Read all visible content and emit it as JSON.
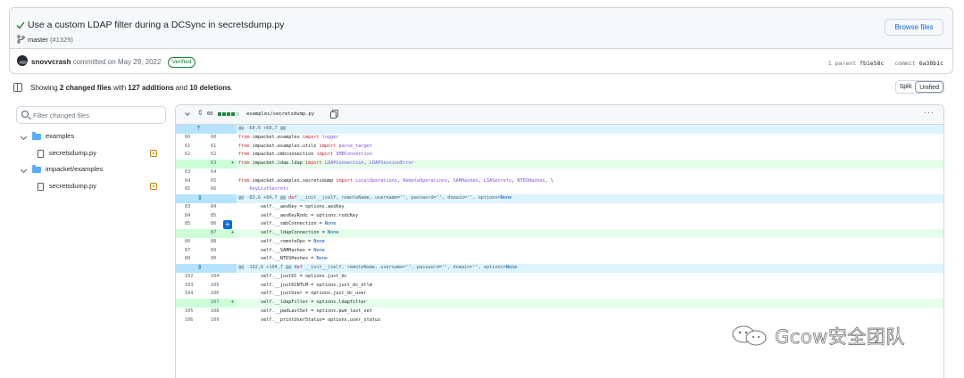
{
  "commit": {
    "title": "Use a custom LDAP filter during a DCSync in secretsdump.py",
    "branch": "master",
    "pr": "(#1329)",
    "browse_label": "Browse files",
    "author": "snovvcrash",
    "committed_text": "committed on May 29, 2022",
    "verified_label": "Verified",
    "parent_label": "1 parent",
    "parent_sha": "fb1e58c",
    "commit_label": "commit",
    "commit_sha": "6a38b1c"
  },
  "summary": {
    "prefix": "Showing",
    "files": "2 changed files",
    "mid": "with",
    "additions": "127 additions",
    "and": "and",
    "deletions": "10 deletions",
    "suffix": ".",
    "split_label": "Split",
    "unified_label": "Unified"
  },
  "tree": {
    "filter_placeholder": "Filter changed files",
    "items": [
      {
        "label": "examples"
      },
      {
        "label": "secretsdump.py"
      },
      {
        "label": "impacket/examples"
      },
      {
        "label": "secretsdump.py"
      }
    ]
  },
  "diff_header": {
    "count": "60",
    "path": "examples/secretsdump.py",
    "more": "···",
    "expand": "⇕"
  },
  "diff_lines": [
    {
      "type": "hunk",
      "old": "",
      "new": "",
      "code": "@@ -60,6 +60,7 @@"
    },
    {
      "type": "ctx",
      "old": "60",
      "new": "60",
      "code": "from impacket.examples import logger"
    },
    {
      "type": "ctx",
      "old": "61",
      "new": "61",
      "code": "from impacket.examples.utils import parse_target"
    },
    {
      "type": "ctx",
      "old": "62",
      "new": "62",
      "code": "from impacket.smbconnection import SMBConnection"
    },
    {
      "type": "add",
      "old": "",
      "new": "63",
      "code": "from impacket.ldap.ldap import LDAPConnection, LDAPSessionError"
    },
    {
      "type": "ctx",
      "old": "63",
      "new": "64",
      "code": ""
    },
    {
      "type": "ctx",
      "old": "64",
      "new": "65",
      "code": "from impacket.examples.secretsdump import LocalOperations, RemoteOperations, SAMHashes, LSASecrets, NTDSHashes, \\"
    },
    {
      "type": "ctx",
      "old": "65",
      "new": "66",
      "code": "    KeyListSecrets"
    },
    {
      "type": "hunk",
      "old": "",
      "new": "",
      "code": "@@ -83,6 +84,7 @@ def __init__(self, remoteName, username='', password='', domain='', options=None"
    },
    {
      "type": "ctx",
      "old": "83",
      "new": "84",
      "code": "        self.__aesKey = options.aesKey"
    },
    {
      "type": "ctx",
      "old": "84",
      "new": "85",
      "code": "        self.__aesKeyRodc = options.rodcKey"
    },
    {
      "type": "ctx",
      "old": "85",
      "new": "86",
      "code": "        self.__smbConnection = None"
    },
    {
      "type": "add",
      "old": "",
      "new": "87",
      "code": "        self.__ldapConnection = None"
    },
    {
      "type": "ctx",
      "old": "86",
      "new": "88",
      "code": "        self.__remoteOps = None"
    },
    {
      "type": "ctx",
      "old": "87",
      "new": "89",
      "code": "        self.__SAMHashes = None"
    },
    {
      "type": "ctx",
      "old": "88",
      "new": "90",
      "code": "        self.__NTDSHashes = None"
    },
    {
      "type": "hunk",
      "old": "",
      "new": "",
      "code": "@@ -102,6 +104,7 @@ def __init__(self, remoteName, username='', password='', domain='', options=None"
    },
    {
      "type": "ctx",
      "old": "102",
      "new": "104",
      "code": "        self.__justDC = options.just_dc"
    },
    {
      "type": "ctx",
      "old": "103",
      "new": "105",
      "code": "        self.__justDCNTLM = options.just_dc_ntlm"
    },
    {
      "type": "ctx",
      "old": "104",
      "new": "106",
      "code": "        self.__justUser = options.just_dc_user"
    },
    {
      "type": "add",
      "old": "",
      "new": "107",
      "code": "        self.__ldapFilter = options.ldapfilter"
    },
    {
      "type": "ctx",
      "old": "105",
      "new": "108",
      "code": "        self.__pwdLastSet = options.pwd_last_set"
    },
    {
      "type": "ctx",
      "old": "106",
      "new": "109",
      "code": "        self.__printUserStatus= options.user_status"
    }
  ],
  "watermark": {
    "text": "Gcow安全团队"
  },
  "colors": {
    "accent": "#0969da",
    "addition": "#1f883d",
    "addition_bg": "#e6ffec",
    "hunk_bg": "#ddf4ff",
    "deletion": "#cf222e"
  },
  "icons": [
    "check-icon",
    "branch-icon",
    "file-diff-icon",
    "search-icon",
    "chevron-down-icon",
    "folder-icon",
    "file-icon",
    "file-modified-icon",
    "unfold-icon",
    "copy-icon",
    "kebab-icon",
    "plus-icon"
  ]
}
